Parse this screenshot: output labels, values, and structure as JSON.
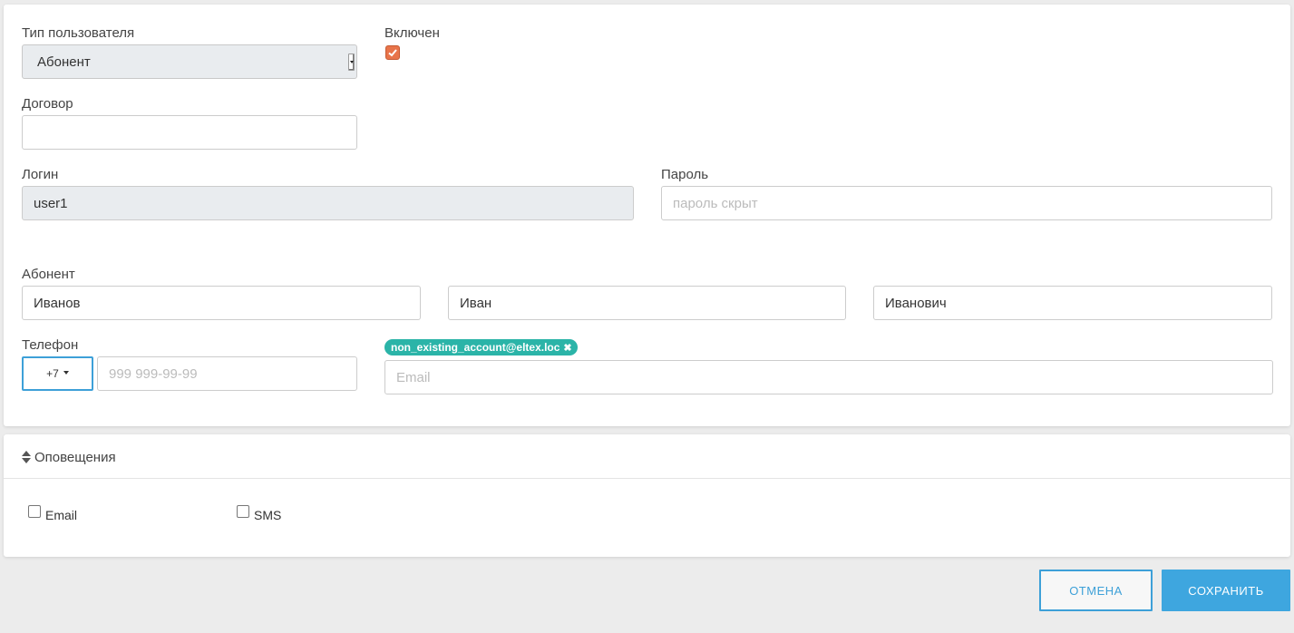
{
  "form": {
    "user_type": {
      "label": "Тип пользователя",
      "value": "Абонент"
    },
    "enabled": {
      "label": "Включен",
      "checked": true,
      "color": "#e8744a"
    },
    "contract": {
      "label": "Договор",
      "value": ""
    },
    "login": {
      "label": "Логин",
      "value": "user1"
    },
    "password": {
      "label": "Пароль",
      "placeholder": "пароль скрыт"
    },
    "subscriber": {
      "label": "Абонент",
      "last_name": "Иванов",
      "first_name": "Иван",
      "middle_name": "Иванович"
    },
    "phone": {
      "label": "Телефон",
      "code": "+7",
      "placeholder": "999 999-99-99"
    },
    "email": {
      "tag": "non_existing_account@eltex.loc",
      "tag_color": "#2bb4a8",
      "placeholder": "Email"
    }
  },
  "notifications": {
    "title": "Оповещения",
    "options": [
      {
        "label": "Email",
        "checked": false
      },
      {
        "label": "SMS",
        "checked": false
      }
    ]
  },
  "buttons": {
    "cancel": "ОТМЕНА",
    "save": "СОХРАНИТЬ",
    "accent": "#3da0d8"
  }
}
